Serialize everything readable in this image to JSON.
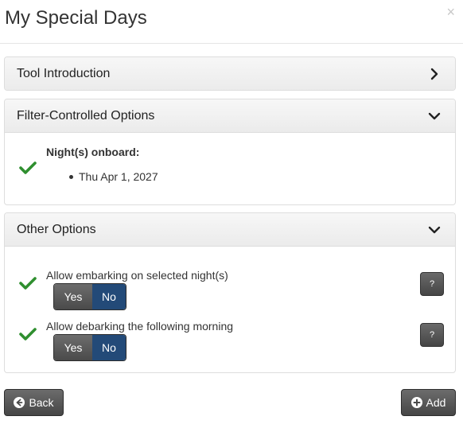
{
  "modal": {
    "title": "My Special Days",
    "close": "×"
  },
  "panels": {
    "intro": {
      "title": "Tool Introduction"
    },
    "filter": {
      "title": "Filter-Controlled Options",
      "nights_label": "Night(s) onboard:",
      "nights": [
        "Thu Apr 1, 2027"
      ]
    },
    "other": {
      "title": "Other Options",
      "options": [
        {
          "label": "Allow embarking on selected night(s)",
          "yes": "Yes",
          "no": "No",
          "selected": "No",
          "help": "?"
        },
        {
          "label": "Allow debarking the following morning",
          "yes": "Yes",
          "no": "No",
          "selected": "No",
          "help": "?"
        }
      ]
    }
  },
  "footer": {
    "back_label": "Back",
    "add_label": "Add"
  },
  "colors": {
    "check": "#2f8f2f",
    "toggle_selected": "#234a78",
    "button_dark": "#555555"
  }
}
